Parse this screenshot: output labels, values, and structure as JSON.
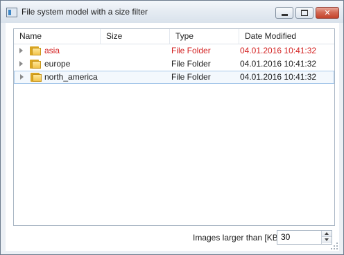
{
  "window": {
    "title": "File system model with a size filter",
    "icon": "app-window-icon",
    "controls": [
      "minimize",
      "maximize",
      "close"
    ]
  },
  "tree": {
    "columns": [
      "Name",
      "Size",
      "Type",
      "Date Modified"
    ],
    "rows": [
      {
        "name": "asia",
        "size": "",
        "type": "File Folder",
        "date": "04.01.2016 10:41:32",
        "color": "#d32020",
        "icon": "folder-icon",
        "current": false
      },
      {
        "name": "europe",
        "size": "",
        "type": "File Folder",
        "date": "04.01.2016 10:41:32",
        "color": "#1a1a1a",
        "icon": "folder-icon",
        "current": false
      },
      {
        "name": "north_america",
        "size": "",
        "type": "File Folder",
        "date": "04.01.2016 10:41:32",
        "color": "#1a1a1a",
        "icon": "folder-icon",
        "current": true
      }
    ]
  },
  "filter": {
    "label": "Images larger than [KB]",
    "value": "30"
  },
  "colors": {
    "highlight_text": "#d32020",
    "selection_border": "#a7c8ea",
    "close_button": "#c4432c"
  }
}
